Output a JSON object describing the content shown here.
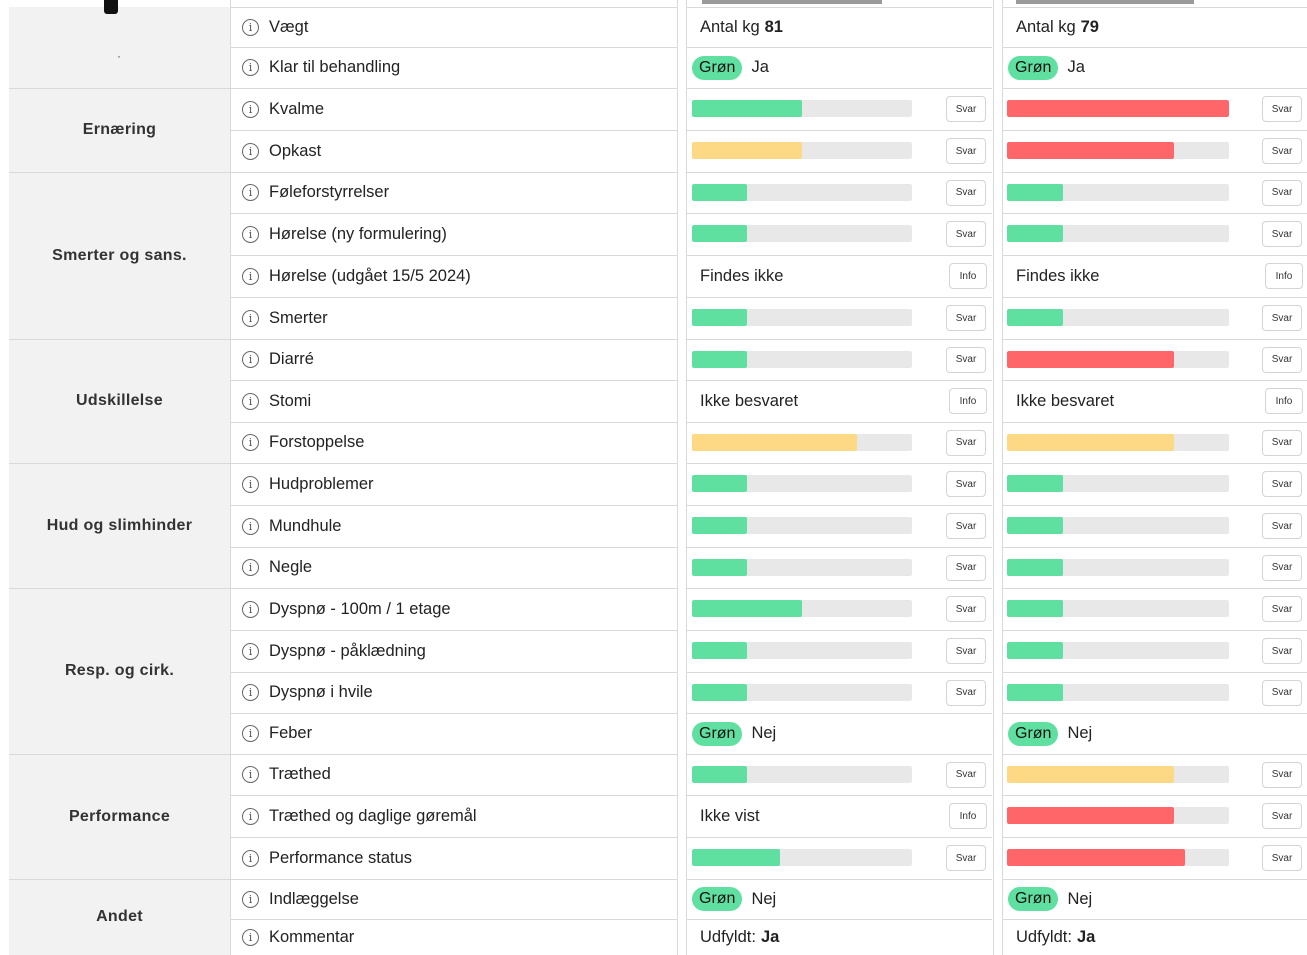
{
  "colors": {
    "green": "#5fe0a0",
    "yellow": "#fdd985",
    "red": "#ff6669",
    "track": "#e8e8e8"
  },
  "top_category_label": "·",
  "categories": [
    {
      "label": "Ernæring"
    },
    {
      "label": "Smerter og sans."
    },
    {
      "label": "Udskillelse"
    },
    {
      "label": "Hud og slimhinder"
    },
    {
      "label": "Resp. og cirk."
    },
    {
      "label": "Performance"
    },
    {
      "label": "Andet"
    }
  ],
  "rows": [
    {
      "label": "Vægt",
      "c1": {
        "type": "weight",
        "prefix": "Antal kg",
        "value": "81"
      },
      "c2": {
        "type": "weight",
        "prefix": "Antal kg",
        "value": "79"
      }
    },
    {
      "label": "Klar til behandling",
      "c1": {
        "type": "pill",
        "pill": "Grøn",
        "text": "Ja"
      },
      "c2": {
        "type": "pill",
        "pill": "Grøn",
        "text": "Ja"
      }
    },
    {
      "label": "Kvalme",
      "c1": {
        "type": "bar",
        "level": 0.5,
        "color": "green",
        "button": "Svar"
      },
      "c2": {
        "type": "bar",
        "level": 1.0,
        "color": "red",
        "button": "Svar"
      }
    },
    {
      "label": "Opkast",
      "c1": {
        "type": "bar",
        "level": 0.5,
        "color": "yellow",
        "button": "Svar"
      },
      "c2": {
        "type": "bar",
        "level": 0.75,
        "color": "red",
        "button": "Svar"
      }
    },
    {
      "label": "Føleforstyrrelser",
      "c1": {
        "type": "bar",
        "level": 0.25,
        "color": "green",
        "button": "Svar"
      },
      "c2": {
        "type": "bar",
        "level": 0.25,
        "color": "green",
        "button": "Svar"
      }
    },
    {
      "label": "Hørelse (ny formulering)",
      "c1": {
        "type": "bar",
        "level": 0.25,
        "color": "green",
        "button": "Svar"
      },
      "c2": {
        "type": "bar",
        "level": 0.25,
        "color": "green",
        "button": "Svar"
      }
    },
    {
      "label": "Hørelse (udgået 15/5 2024)",
      "c1": {
        "type": "text",
        "text": "Findes ikke",
        "button": "Info"
      },
      "c2": {
        "type": "text",
        "text": "Findes ikke",
        "button": "Info"
      }
    },
    {
      "label": "Smerter",
      "c1": {
        "type": "bar",
        "level": 0.25,
        "color": "green",
        "button": "Svar"
      },
      "c2": {
        "type": "bar",
        "level": 0.25,
        "color": "green",
        "button": "Svar"
      }
    },
    {
      "label": "Diarré",
      "c1": {
        "type": "bar",
        "level": 0.25,
        "color": "green",
        "button": "Svar"
      },
      "c2": {
        "type": "bar",
        "level": 0.75,
        "color": "red",
        "button": "Svar"
      }
    },
    {
      "label": "Stomi",
      "c1": {
        "type": "text",
        "text": "Ikke besvaret",
        "button": "Info"
      },
      "c2": {
        "type": "text",
        "text": "Ikke besvaret",
        "button": "Info"
      }
    },
    {
      "label": "Forstoppelse",
      "c1": {
        "type": "bar",
        "level": 0.75,
        "color": "yellow",
        "button": "Svar"
      },
      "c2": {
        "type": "bar",
        "level": 0.75,
        "color": "yellow",
        "button": "Svar"
      }
    },
    {
      "label": "Hudproblemer",
      "c1": {
        "type": "bar",
        "level": 0.25,
        "color": "green",
        "button": "Svar"
      },
      "c2": {
        "type": "bar",
        "level": 0.25,
        "color": "green",
        "button": "Svar"
      }
    },
    {
      "label": "Mundhule",
      "c1": {
        "type": "bar",
        "level": 0.25,
        "color": "green",
        "button": "Svar"
      },
      "c2": {
        "type": "bar",
        "level": 0.25,
        "color": "green",
        "button": "Svar"
      }
    },
    {
      "label": "Negle",
      "c1": {
        "type": "bar",
        "level": 0.25,
        "color": "green",
        "button": "Svar"
      },
      "c2": {
        "type": "bar",
        "level": 0.25,
        "color": "green",
        "button": "Svar"
      }
    },
    {
      "label": "Dyspnø - 100m / 1 etage",
      "c1": {
        "type": "bar",
        "level": 0.5,
        "color": "green",
        "button": "Svar"
      },
      "c2": {
        "type": "bar",
        "level": 0.25,
        "color": "green",
        "button": "Svar"
      }
    },
    {
      "label": "Dyspnø - påklædning",
      "c1": {
        "type": "bar",
        "level": 0.25,
        "color": "green",
        "button": "Svar"
      },
      "c2": {
        "type": "bar",
        "level": 0.25,
        "color": "green",
        "button": "Svar"
      }
    },
    {
      "label": "Dyspnø i hvile",
      "c1": {
        "type": "bar",
        "level": 0.25,
        "color": "green",
        "button": "Svar"
      },
      "c2": {
        "type": "bar",
        "level": 0.25,
        "color": "green",
        "button": "Svar"
      }
    },
    {
      "label": "Feber",
      "c1": {
        "type": "pill",
        "pill": "Grøn",
        "text": "Nej"
      },
      "c2": {
        "type": "pill",
        "pill": "Grøn",
        "text": "Nej"
      }
    },
    {
      "label": "Træthed",
      "c1": {
        "type": "bar",
        "level": 0.25,
        "color": "green",
        "button": "Svar"
      },
      "c2": {
        "type": "bar",
        "level": 0.75,
        "color": "yellow",
        "button": "Svar"
      }
    },
    {
      "label": "Træthed og daglige gøremål",
      "c1": {
        "type": "text",
        "text": "Ikke vist",
        "button": "Info"
      },
      "c2": {
        "type": "bar",
        "level": 0.75,
        "color": "red",
        "button": "Svar"
      }
    },
    {
      "label": "Performance status",
      "c1": {
        "type": "bar",
        "level": 0.4,
        "color": "green",
        "button": "Svar"
      },
      "c2": {
        "type": "bar",
        "level": 0.8,
        "color": "red",
        "button": "Svar"
      }
    },
    {
      "label": "Indlæggelse",
      "c1": {
        "type": "pill",
        "pill": "Grøn",
        "text": "Nej"
      },
      "c2": {
        "type": "pill",
        "pill": "Grøn",
        "text": "Nej"
      }
    },
    {
      "label": "Kommentar",
      "c1": {
        "type": "filled",
        "prefix": "Udfyldt:",
        "value": "Ja"
      },
      "c2": {
        "type": "filled",
        "prefix": "Udfyldt:",
        "value": "Ja"
      }
    }
  ]
}
